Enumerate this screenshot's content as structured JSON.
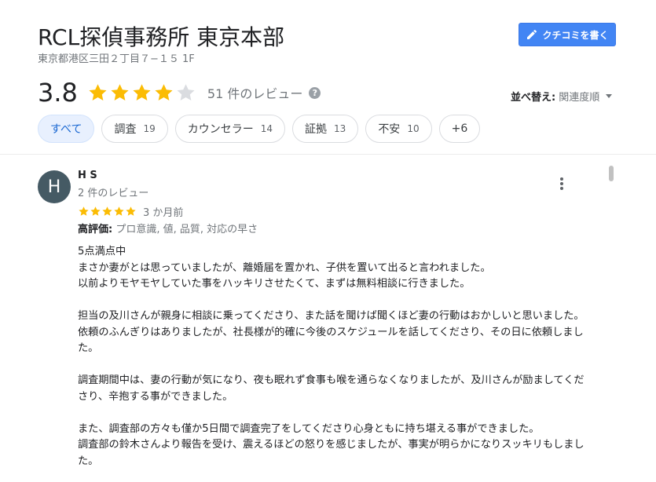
{
  "header": {
    "title": "RCL探偵事務所 東京本部",
    "address": "東京都港区三田２丁目７−１５ 1F",
    "write_review_label": "クチコミを書く"
  },
  "summary": {
    "rating": "3.8",
    "rating_value": 3.8,
    "stars_max": 5,
    "review_count": "51 件のレビュー",
    "help_glyph": "?"
  },
  "sort": {
    "label": "並べ替え:",
    "value": "関連度順"
  },
  "chips": [
    {
      "label": "すべて",
      "count": ""
    },
    {
      "label": "調査",
      "count": "19"
    },
    {
      "label": "カウンセラー",
      "count": "14"
    },
    {
      "label": "証拠",
      "count": "13"
    },
    {
      "label": "不安",
      "count": "10"
    },
    {
      "label": "+6",
      "count": ""
    }
  ],
  "review": {
    "avatar_letter": "H",
    "avatar_color": "#455a64",
    "author": "H S",
    "author_meta": "2 件のレビュー",
    "stars": 5,
    "date": "3 か月前",
    "highlights_label": "高評価:",
    "highlights_value": "プロ意識, 値, 品質, 対応の早さ",
    "paragraphs": [
      "5点満点中\nまさか妻がとは思っていましたが、離婚届を置かれ、子供を置いて出ると言われました。\n以前よりモヤモヤしていた事をハッキリさせたくて、まずは無料相談に行きました。",
      "担当の及川さんが親身に相談に乗ってくださり、また話を聞けば聞くほど妻の行動はおかしいと思いました。\n依頼のふんぎりはありましたが、社長様が的確に今後のスケジュールを話してくださり、その日に依頼しました。",
      "調査期間中は、妻の行動が気になり、夜も眠れず食事も喉を通らなくなりましたが、及川さんが励ましてくださり、辛抱する事ができました。",
      "また、調査部の方々も僅か5日間で調査完了をしてくださり心身ともに持ち堪える事ができました。\n調査部の鈴木さんより報告を受け、震えるほどの怒りを感じましたが、事実が明らかになりスッキリもしました。"
    ]
  },
  "colors": {
    "star_filled": "#fbbc04",
    "star_empty": "#dadce0",
    "accent": "#4285f4"
  }
}
